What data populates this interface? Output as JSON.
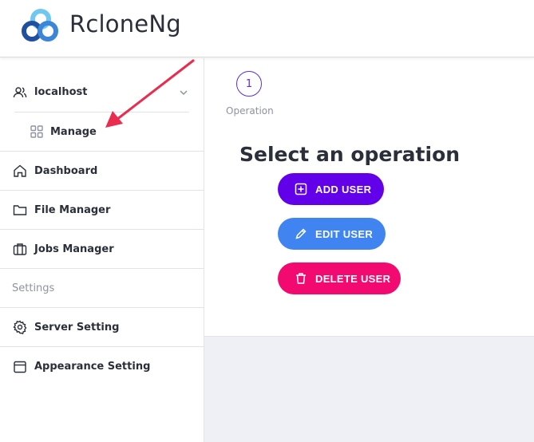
{
  "app": {
    "title": "RcloneNg"
  },
  "sidebar": {
    "server": {
      "label": "localhost",
      "icon": "users-icon"
    },
    "sub_items": [
      {
        "label": "Manage",
        "icon": "grid-icon"
      }
    ],
    "items": [
      {
        "label": "Dashboard",
        "icon": "home-icon"
      },
      {
        "label": "File Manager",
        "icon": "folder-icon"
      },
      {
        "label": "Jobs Manager",
        "icon": "briefcase-icon"
      }
    ],
    "section_label": "Settings",
    "settings_items": [
      {
        "label": "Server Setting",
        "icon": "gear-icon"
      },
      {
        "label": "Appearance Setting",
        "icon": "browser-icon"
      }
    ]
  },
  "stepper": {
    "step_number": "1",
    "step_label": "Operation"
  },
  "main": {
    "heading": "Select an operation",
    "buttons": {
      "add": "ADD USER",
      "edit": "EDIT USER",
      "delete": "DELETE USER"
    }
  },
  "colors": {
    "add_button": "#6200ea",
    "edit_button": "#3f84f0",
    "delete_button": "#f20a70",
    "annotation_arrow": "#ea2c4f"
  }
}
